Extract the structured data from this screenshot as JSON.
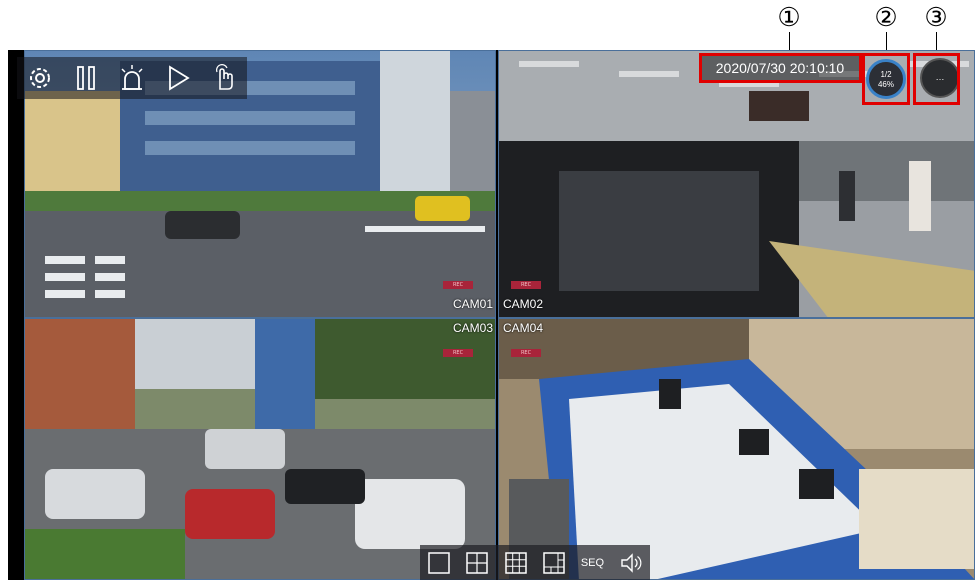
{
  "callouts": [
    "①",
    "②",
    "③"
  ],
  "datetime": "2020/07/30 20:10:10",
  "page_indicator": {
    "page": "1/2",
    "percent": "46%"
  },
  "more_button_label": "…",
  "toolbar": {
    "icons": [
      "gear-icon",
      "pause-icon",
      "alarm-icon",
      "play-icon",
      "touch-icon"
    ]
  },
  "cameras": [
    {
      "label": "CAM01",
      "badge": "REC"
    },
    {
      "label": "CAM02",
      "badge": "REC"
    },
    {
      "label": "CAM03",
      "badge": "REC"
    },
    {
      "label": "CAM04",
      "badge": "REC"
    }
  ],
  "bottom_bar": {
    "seq_label": "SEQ",
    "icons": [
      "layout-1-icon",
      "layout-4-icon",
      "layout-9-icon",
      "layout-custom-icon",
      "seq-button",
      "speaker-icon"
    ]
  },
  "colors": {
    "highlight_red": "#e00000",
    "panel_border": "#4a6f9a",
    "rec_badge": "#a8243a",
    "page_ring": "#3a82c8"
  }
}
